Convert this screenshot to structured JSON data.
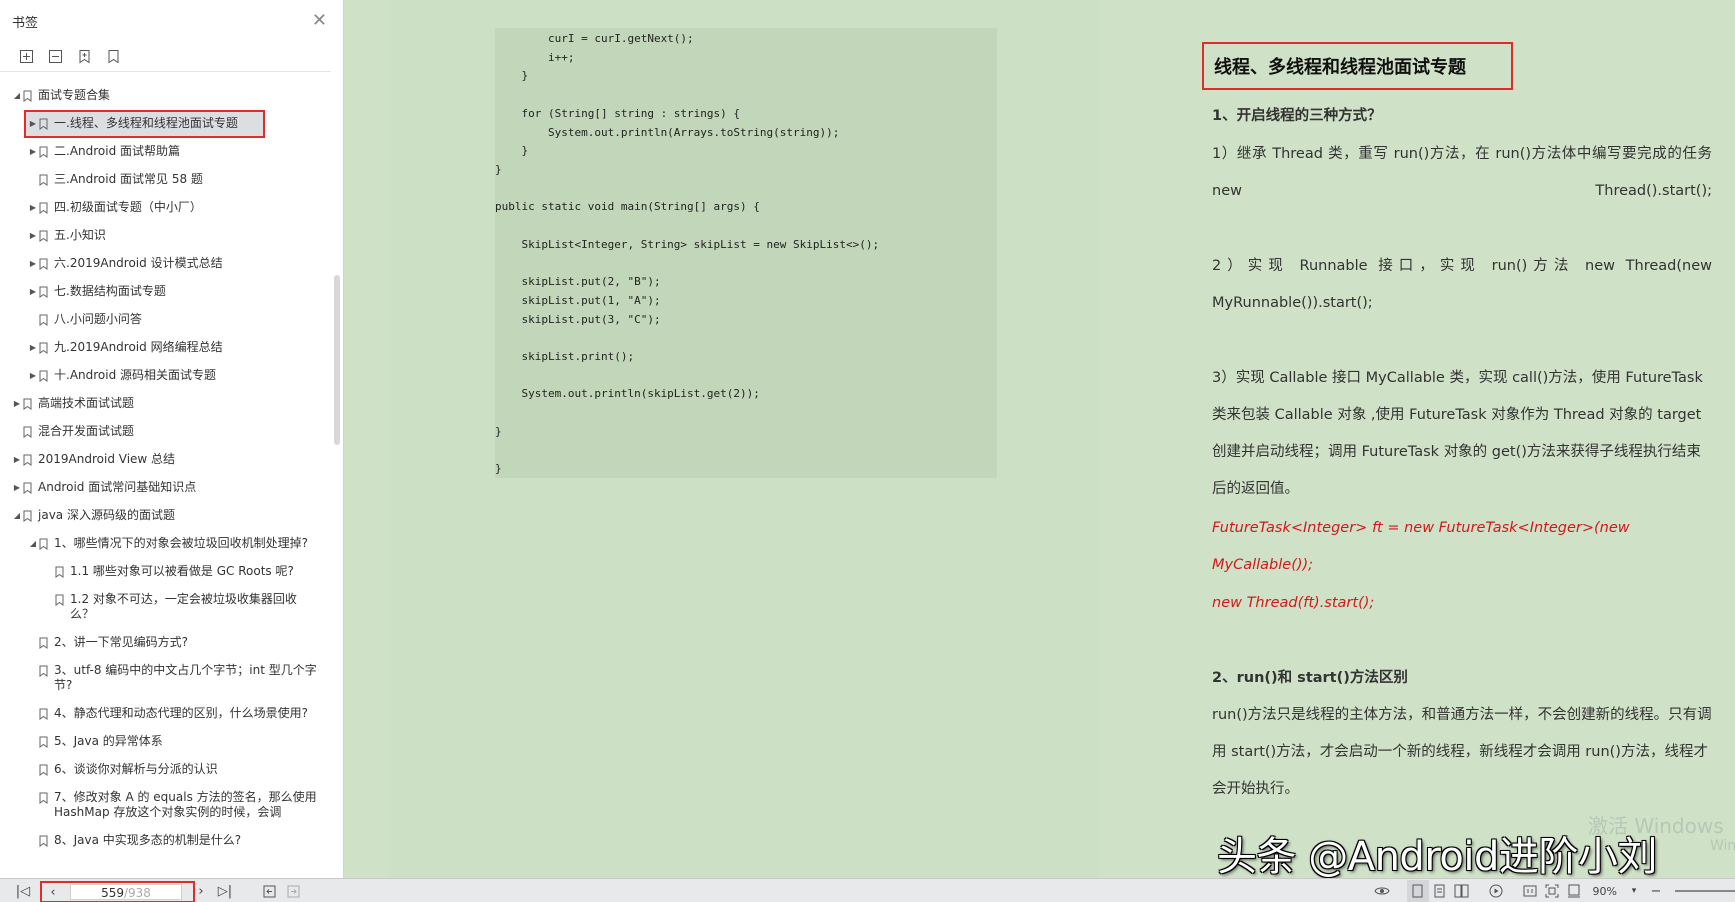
{
  "sidebar": {
    "title": "书签",
    "items": [
      {
        "label": "面试专题合集",
        "level": 0,
        "toggle": "open"
      },
      {
        "label": "一.线程、多线程和线程池面试专题",
        "level": 1,
        "toggle": "closed",
        "selected": true
      },
      {
        "label": "二.Android 面试帮助篇",
        "level": 1,
        "toggle": "closed"
      },
      {
        "label": "三.Android 面试常见 58 题",
        "level": 1,
        "toggle": "none"
      },
      {
        "label": "四.初级面试专题（中小厂）",
        "level": 1,
        "toggle": "closed"
      },
      {
        "label": "五.小知识",
        "level": 1,
        "toggle": "closed"
      },
      {
        "label": "六.2019Android 设计模式总结",
        "level": 1,
        "toggle": "closed"
      },
      {
        "label": "七.数据结构面试专题",
        "level": 1,
        "toggle": "closed"
      },
      {
        "label": "八.小问题小问答",
        "level": 1,
        "toggle": "none"
      },
      {
        "label": "九.2019Android 网络编程总结",
        "level": 1,
        "toggle": "closed"
      },
      {
        "label": "十.Android 源码相关面试专题",
        "level": 1,
        "toggle": "closed"
      },
      {
        "label": "高端技术面试试题",
        "level": 0,
        "toggle": "closed"
      },
      {
        "label": "混合开发面试试题",
        "level": 0,
        "toggle": "none"
      },
      {
        "label": "2019Android View 总结",
        "level": 0,
        "toggle": "closed"
      },
      {
        "label": "Android 面试常问基础知识点",
        "level": 0,
        "toggle": "closed"
      },
      {
        "label": "java 深入源码级的面试题",
        "level": 0,
        "toggle": "open"
      },
      {
        "label": "1、哪些情况下的对象会被垃圾回收机制处理掉?",
        "level": 1,
        "toggle": "open"
      },
      {
        "label": "1.1 哪些对象可以被看做是 GC Roots 呢?",
        "level": 2,
        "toggle": "none"
      },
      {
        "label": "1.2 对象不可达，一定会被垃圾收集器回收么？",
        "level": 2,
        "toggle": "none"
      },
      {
        "label": "2、讲一下常见编码方式?",
        "level": 1,
        "toggle": "none"
      },
      {
        "label": "3、utf-8 编码中的中文占几个字节；int 型几个字节?",
        "level": 1,
        "toggle": "none"
      },
      {
        "label": "4、静态代理和动态代理的区别，什么场景使用?",
        "level": 1,
        "toggle": "none"
      },
      {
        "label": "5、Java 的异常体系",
        "level": 1,
        "toggle": "none"
      },
      {
        "label": "6、谈谈你对解析与分派的认识",
        "level": 1,
        "toggle": "none"
      },
      {
        "label": "7、修改对象 A 的 equals 方法的签名，那么使用 HashMap 存放这个对象实例的时候，会调",
        "level": 1,
        "toggle": "none"
      },
      {
        "label": "8、Java 中实现多态的机制是什么?",
        "level": 1,
        "toggle": "none"
      }
    ]
  },
  "code": "        curI = curI.getNext();\n        i++;\n    }\n\n    for (String[] string : strings) {\n        System.out.println(Arrays.toString(string));\n    }\n}\n\npublic static void main(String[] args) {\n\n    SkipList<Integer, String> skipList = new SkipList<>();\n\n    skipList.put(2, \"B\");\n    skipList.put(1, \"A\");\n    skipList.put(3, \"C\");\n\n    skipList.print();\n\n    System.out.println(skipList.get(2));\n\n}\n\n}",
  "doc": {
    "title": "线程、多线程和线程池面试专题",
    "h1": "1、开启线程的三种方式？",
    "p1": "1）继承 Thread 类，重写 run()方法，在 run()方法体中编写要完成的任务 new Thread().start();",
    "p2": "2）实现 Runnable 接口，实现 run()方法 new Thread(new MyRunnable()).start();",
    "p3": "3）实现 Callable 接口 MyCallable 类，实现 call()方法，使用 FutureTask 类来包装 Callable 对象 ,使用 FutureTask 对象作为 Thread 对象的 target 创建并启动线程；调用 FutureTask 对象的 get()方法来获得子线程执行结束后的返回值。",
    "code1": "FutureTask<Integer> ft = new FutureTask<Integer>(new MyCallable());",
    "code2": "new Thread(ft).start();",
    "h2": "2、run()和 start()方法区别",
    "p4": "run()方法只是线程的主体方法，和普通方法一样，不会创建新的线程。只有调用 start()方法，才会启动一个新的线程，新线程才会调用 run()方法，线程才会开始执行。"
  },
  "watermark": {
    "line1": "激活 Windows",
    "line2": "Win"
  },
  "overlay": "头条 @Android进阶小刘",
  "statusbar": {
    "current_page": "559",
    "total_pages": "/938",
    "zoom": "90%"
  },
  "colors": {
    "highlight_border": "#e22b2b",
    "page_bg": "#cfe1c7",
    "red_code": "#d11a1a"
  }
}
